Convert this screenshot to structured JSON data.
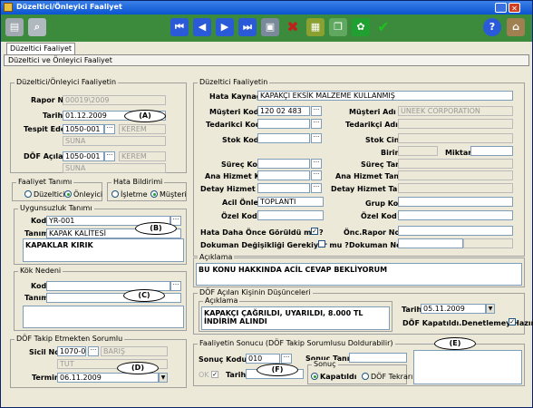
{
  "window": {
    "title": "Düzeltici/Önleyici Faaliyet"
  },
  "tab": {
    "label": "Düzeltici Faaliyet"
  },
  "section_title": "Düzeltici ve Önleyici Faaliyet",
  "left": {
    "group1_title": "Düzeltici/Önleyici Faaliyetin",
    "rapor_no_label": "Rapor No",
    "rapor_no_value": "00019\\2009",
    "tarih_label": "Tarih",
    "tarih_value": "01.12.2009",
    "tespit_eden_label": "Tespit Eden",
    "tespit_eden_code": "1050-001",
    "tespit_eden_name": "KEREM",
    "tespit_eden_surname": "SUNA",
    "dof_acilan_label": "DÖF Açılan",
    "dof_acilan_code": "1050-001",
    "dof_acilan_name": "KEREM",
    "dof_acilan_surname": "SUNA",
    "faaliyet_tanimi_title": "Faaliyet Tanımı",
    "duzeltici_label": "Düzeltici",
    "onleyici_label": "Önleyici",
    "hata_bildirimi_title": "Hata Bildirimi",
    "isletme_label": "İşletme",
    "musteri_label": "Müşteri",
    "uygunsuzluk_title": "Uygunsuzluk Tanımı",
    "kod_label": "Kod",
    "kod_value": "YR-001",
    "tanim_label": "Tanım",
    "tanim_value": "KAPAK KALİTESİ",
    "uygunsuzluk_text": "KAPAKLAR KIRIK",
    "kok_neden_title": "Kök Nedeni",
    "kok_kod_label": "Kod",
    "kok_tanim_label": "Tanım",
    "takip_title": "DÖF Takip Etmekten Sorumlu",
    "sicil_no_label": "Sicil No",
    "sicil_no_value": "1070-001",
    "takip_name": "BARIŞ",
    "takip_surname": "TUT",
    "termin_label": "Termin",
    "termin_value": "06.11.2009"
  },
  "right": {
    "group_title": "Düzeltici Faaliyetin",
    "hata_kaynagi_label": "Hata Kaynağı",
    "hata_kaynagi_value": "KAPAKÇI EKSİK MALZEME KULLANMIŞ",
    "musteri_kodu_label": "Müşteri Kodu",
    "musteri_kodu_value": "120 02 483",
    "musteri_adi_label": "Müşteri Adı",
    "musteri_adi_value": "UNEEK CORPORATION",
    "tedarikci_kodu_label": "Tedarikci Kodu",
    "tedarikci_adi_label": "Tedarikçi Adı",
    "stok_kodu_label": "Stok Kodu",
    "stok_cinsi_label": "Stok Cinsi",
    "birim_label": "Birim",
    "miktari_label": "Miktarı",
    "surec_kodu_label": "Süreç Kodu",
    "surec_tanimi_label": "Süreç Tanımı",
    "ana_hizmet_kodu_label": "Ana Hizmet Kodu",
    "ana_hizmet_tanimi_label": "Ana Hizmet Tanımı",
    "detay_hizmet_kodu_label": "Detay Hizmet Kodu",
    "detay_hizmet_tanimi_label": "Detay Hizmet Tanımı",
    "acil_onlem_label": "Acil Önlem",
    "acil_onlem_value": "TOPLANTI",
    "grup_kodu_label": "Grup Kodu",
    "ozel_kod_1_label": "Özel Kod [I]",
    "ozel_kod_2_label": "Özel Kod [II]",
    "hata_daha_once_label": "Hata Daha Önce Görüldü mü ?",
    "onc_rapor_no_label": "Önc.Rapor No",
    "dokuman_degisikligi_label": "Dokuman Değişikliği Gerekiyor mu ?",
    "dokuman_no_label": "Dokuman No",
    "aciklama_title": "Açıklama",
    "aciklama_text": "BU KONU HAKKINDA ACİL CEVAP BEKLİYORUM",
    "dof_acilan_title": "DÖF Açılan Kişinin Düşünceleri",
    "dof_aciklama_title": "Açıklama",
    "dof_aciklama_text": "KAPAKÇI ÇAĞRILDI, UYARILDI, 8.000 TL İNDİRİM ALINDI",
    "dof_tarih_label": "Tarih",
    "dof_tarih_value": "05.11.2009",
    "dof_kapatildi_label": "DÖF Kapatıldı.Denetlemey Hazır",
    "sonuc_title": "Faaliyetin Sonucu (DÖF Takip Sorumlusu Doldurabilir)",
    "sonuc_kodu_label": "Sonuç Kodu",
    "sonuc_kodu_value": "010",
    "sonuc_tanimi_label": "Sonuç Tanımı",
    "ok_label": "OK",
    "sonuc_tarih_label": "Tarih",
    "sonuc_label": "Sonuç",
    "kapatildi_label": "Kapatıldı",
    "dof_tekrari_label": "DÖF Tekrarı"
  },
  "callouts": [
    "(A)",
    "(B)",
    "(C)",
    "(D)",
    "(E)",
    "(F)"
  ],
  "toolbar": {
    "help": "?"
  },
  "colors": {
    "toolbar_bg": "#3c8a3c",
    "nav_blue": "#2a5ad8",
    "title_blue": "#0a54d0"
  }
}
